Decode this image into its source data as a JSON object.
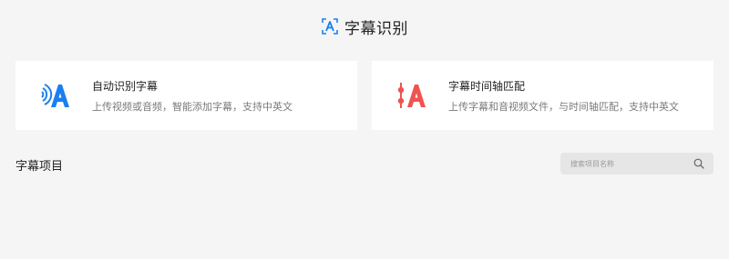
{
  "header": {
    "title": "字幕识别",
    "logo_icon": "subtitle-a-logo-icon"
  },
  "cards": [
    {
      "title": "自动识别字幕",
      "description": "上传视频或音频，智能添加字幕，支持中英文",
      "icon": "audio-wave-a-icon",
      "icon_color": "#1a7ff0"
    },
    {
      "title": "字幕时间轴匹配",
      "description": "上传字幕和音视频文件，与时间轴匹配，支持中英文",
      "icon": "timeline-a-icon",
      "icon_color": "#ef5350"
    }
  ],
  "projects": {
    "section_title": "字幕项目",
    "search_placeholder": "搜索项目名称",
    "search_icon": "search-icon"
  },
  "colors": {
    "background": "#f5f5f5",
    "accent_blue": "#1a7ff0",
    "accent_red": "#ef5350"
  }
}
